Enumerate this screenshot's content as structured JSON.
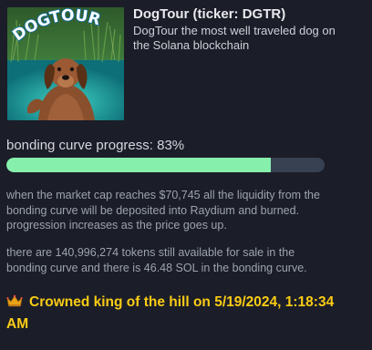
{
  "token": {
    "image_alt": "DOGTOUR",
    "image_logo_text": "DOGTOUR",
    "title": "DogTour (ticker: DGTR)",
    "description": "DogTour the most well traveled dog on the Solana blockchain"
  },
  "bonding_curve": {
    "label": "bonding curve progress: 83%",
    "progress_fraction": 0.83,
    "fill_color": "#86efac",
    "track_color": "#374151"
  },
  "info": {
    "market_cap_text": "when the market cap reaches $70,745 all the liquidity from the bonding curve will be deposited into Raydium and burned. progression increases as the price goes up.",
    "tokens_text": "there are 140,996,274 tokens still available for sale in the bonding curve and there is 46.48 SOL in the bonding curve."
  },
  "koth": {
    "icon": "crown-icon",
    "text": "Crowned king of the hill on 5/19/2024, 1:18:34 AM",
    "color": "#facc15"
  }
}
